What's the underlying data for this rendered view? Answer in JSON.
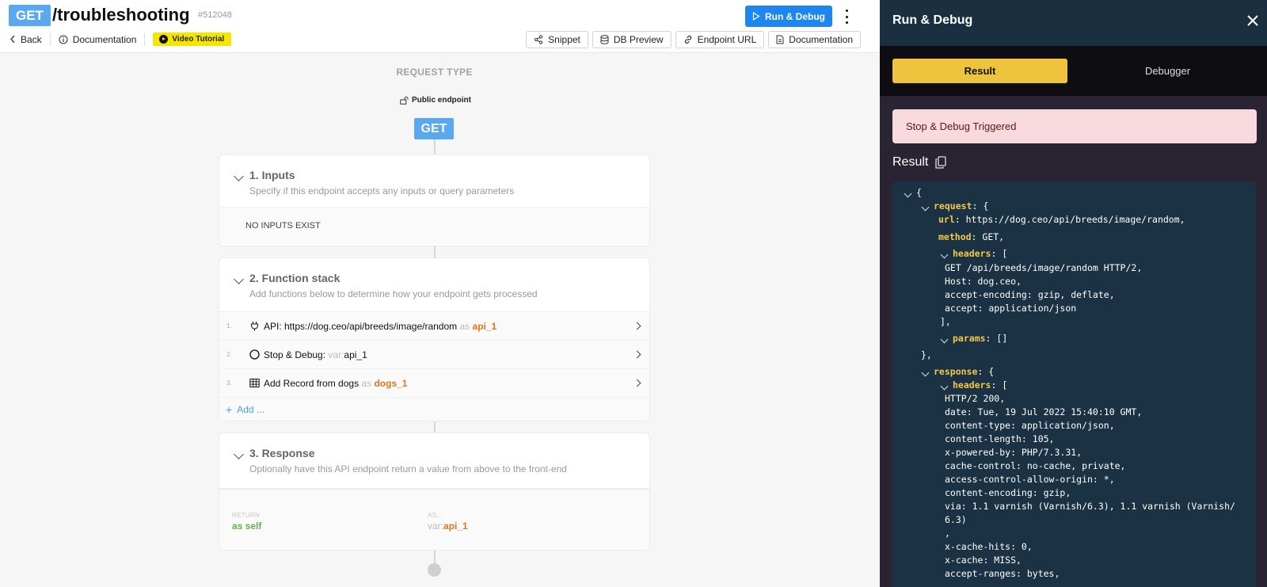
{
  "header": {
    "method": "GET",
    "title": "/troubleshooting",
    "id": "#512048",
    "back_label": "Back",
    "docs_label": "Documentation",
    "video_label": "Video Tutorial",
    "run_label": "Run & Debug",
    "tools": [
      "Snippet",
      "DB Preview",
      "Endpoint URL",
      "Documentation"
    ]
  },
  "canvas": {
    "request_type_label": "REQUEST TYPE",
    "public_label": "Public endpoint",
    "method_pill": "GET",
    "inputs": {
      "title": "1. Inputs",
      "desc": "Specify if this endpoint accepts any inputs or query parameters",
      "empty": "NO INPUTS EXIST"
    },
    "function_stack": {
      "title": "2. Function stack",
      "desc": "Add functions below to determine how your endpoint gets processed",
      "items": [
        {
          "num": "1.",
          "prefix": "API: https://dog.ceo/api/breeds/image/random",
          "as": "as",
          "target": "api_1"
        },
        {
          "num": "2.",
          "prefix": "Stop & Debug:",
          "var": "var:",
          "target": "api_1"
        },
        {
          "num": "3.",
          "prefix": "Add Record from",
          "table": "dogs",
          "as": "as",
          "target": "dogs_1"
        }
      ],
      "add_label": "Add ..."
    },
    "response": {
      "title": "3. Response",
      "desc": "Optionally have this API endpoint return a value from above to the front-end",
      "return_caption": "RETURN",
      "return_value": "as self",
      "as_caption": "AS...",
      "as_var": "var:",
      "as_value": "api_1"
    }
  },
  "panel": {
    "title": "Run & Debug",
    "tab_result": "Result",
    "tab_debugger": "Debugger",
    "alert": "Stop & Debug Triggered",
    "result_label": "Result",
    "code": {
      "open": "{",
      "request_key": "request",
      "request_open": ": {",
      "url_key": "url",
      "url_val": ": https://dog.ceo/api/breeds/image/random,",
      "method_key": "method",
      "method_val": ": GET,",
      "req_headers_key": "headers",
      "req_headers_open": ": [",
      "req_headers": [
        "GET /api/breeds/image/random HTTP/2,",
        "Host: dog.ceo,",
        "accept-encoding: gzip, deflate,",
        "accept: application/json"
      ],
      "req_headers_close": "],",
      "params_key": "params",
      "params_val": ": []",
      "request_close": "},",
      "response_key": "response",
      "response_open": ": {",
      "resp_headers_key": "headers",
      "resp_headers_open": ": [",
      "resp_headers": [
        "HTTP/2 200,",
        "date: Tue, 19 Jul 2022 15:40:10 GMT,",
        "content-type: application/json,",
        "content-length: 105,",
        "x-powered-by: PHP/7.3.31,",
        "cache-control: no-cache, private,",
        "access-control-allow-origin: *,",
        "content-encoding: gzip,",
        "via: 1.1 varnish (Varnish/6.3), 1.1 varnish (Varnish/",
        "6.3)",
        ",",
        "x-cache-hits: 0,",
        "x-cache: MISS,",
        "accept-ranges: bytes,"
      ]
    }
  },
  "colors": {
    "accent_blue": "#1e86f0",
    "get_blue": "#5aa9f0",
    "result_tab": "#eec43e",
    "json_key": "#f1c84a",
    "panel_bg": "#2a2432",
    "code_bg": "#1b3244",
    "alert_bg": "#f8d9dd",
    "orange_var": "#e3741c",
    "green_value": "#62b346"
  }
}
